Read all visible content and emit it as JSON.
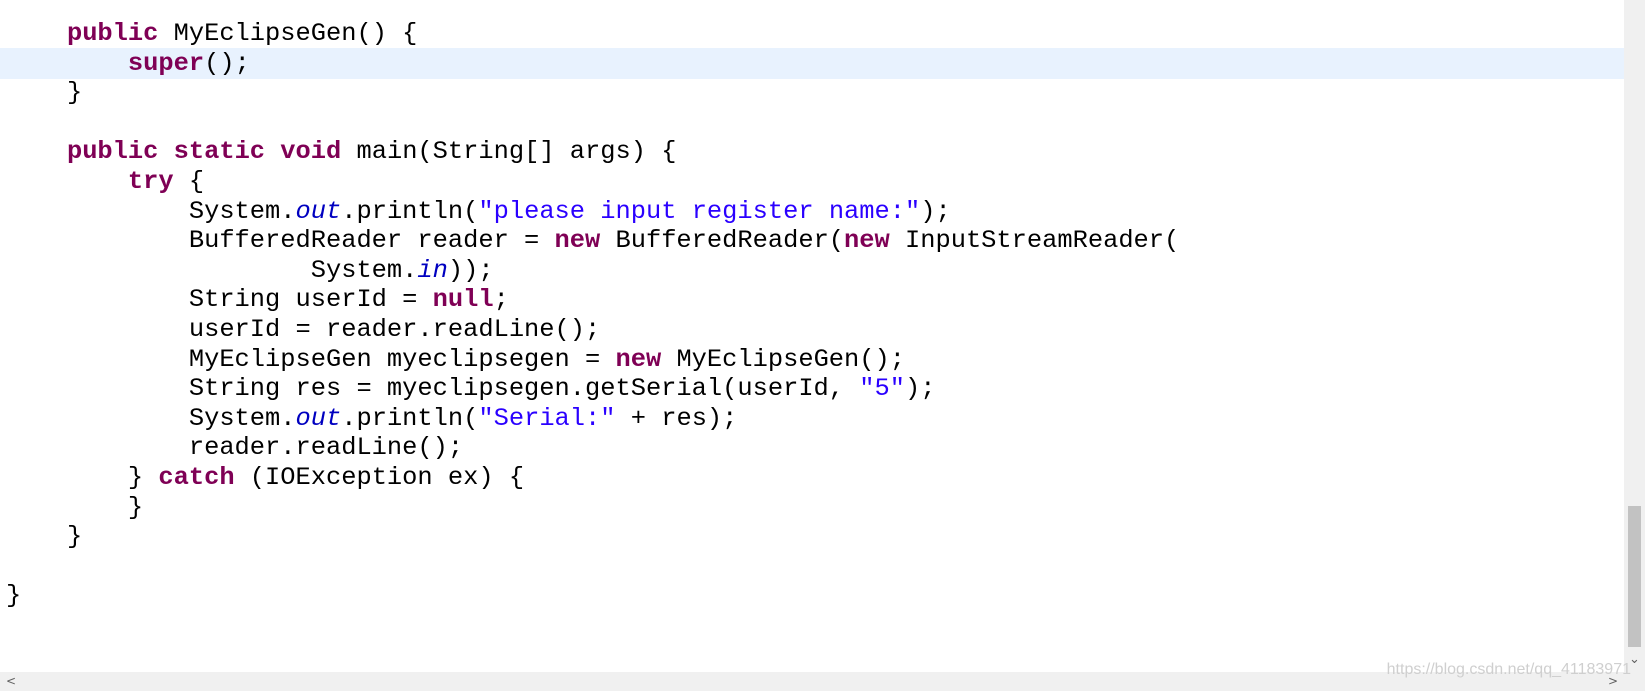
{
  "editor": {
    "lines": [
      {
        "segments": [
          [
            "",
            "    "
          ],
          [
            "kw",
            "public"
          ],
          [
            "",
            " MyEclipseGen() {"
          ]
        ]
      },
      {
        "current": true,
        "segments": [
          [
            "",
            "        "
          ],
          [
            "kw",
            "super"
          ],
          [
            "",
            "();"
          ]
        ]
      },
      {
        "segments": [
          [
            "",
            "    }"
          ]
        ]
      },
      {
        "segments": []
      },
      {
        "segments": [
          [
            "",
            "    "
          ],
          [
            "kw",
            "public"
          ],
          [
            "",
            " "
          ],
          [
            "kw",
            "static"
          ],
          [
            "",
            " "
          ],
          [
            "kw",
            "void"
          ],
          [
            "",
            " main(String[] args) {"
          ]
        ]
      },
      {
        "segments": [
          [
            "",
            "        "
          ],
          [
            "kw",
            "try"
          ],
          [
            "",
            " {"
          ]
        ]
      },
      {
        "segments": [
          [
            "",
            "            System."
          ],
          [
            "fld",
            "out"
          ],
          [
            "",
            ".println("
          ],
          [
            "str",
            "\"please input register name:\""
          ],
          [
            "",
            ");"
          ]
        ]
      },
      {
        "segments": [
          [
            "",
            "            BufferedReader reader = "
          ],
          [
            "kw",
            "new"
          ],
          [
            "",
            " BufferedReader("
          ],
          [
            "kw",
            "new"
          ],
          [
            "",
            " InputStreamReader("
          ]
        ]
      },
      {
        "segments": [
          [
            "",
            "                    System."
          ],
          [
            "fld",
            "in"
          ],
          [
            "",
            "));"
          ]
        ]
      },
      {
        "segments": [
          [
            "",
            "            String userId = "
          ],
          [
            "kw",
            "null"
          ],
          [
            "",
            ";"
          ]
        ]
      },
      {
        "segments": [
          [
            "",
            "            userId = reader.readLine();"
          ]
        ]
      },
      {
        "segments": [
          [
            "",
            "            MyEclipseGen myeclipsegen = "
          ],
          [
            "kw",
            "new"
          ],
          [
            "",
            " MyEclipseGen();"
          ]
        ]
      },
      {
        "segments": [
          [
            "",
            "            String res = myeclipsegen.getSerial(userId, "
          ],
          [
            "str",
            "\"5\""
          ],
          [
            "",
            ");"
          ]
        ]
      },
      {
        "segments": [
          [
            "",
            "            System."
          ],
          [
            "fld",
            "out"
          ],
          [
            "",
            ".println("
          ],
          [
            "str",
            "\"Serial:\""
          ],
          [
            "",
            " + res);"
          ]
        ]
      },
      {
        "segments": [
          [
            "",
            "            reader.readLine();"
          ]
        ]
      },
      {
        "segments": [
          [
            "",
            "        } "
          ],
          [
            "kw",
            "catch"
          ],
          [
            "",
            " (IOException ex) {"
          ]
        ]
      },
      {
        "segments": [
          [
            "",
            "        }"
          ]
        ]
      },
      {
        "segments": [
          [
            "",
            "    }"
          ]
        ]
      },
      {
        "segments": []
      },
      {
        "segments": [
          [
            "",
            "}"
          ]
        ]
      }
    ]
  },
  "scrollbars": {
    "down_arrow": "⌄",
    "left_arrow": "<",
    "right_arrow": ">"
  },
  "watermark": "https://blog.csdn.net/qq_41183971",
  "colors": {
    "keyword": "#7f0055",
    "string": "#2a00ff",
    "field": "#0000c0",
    "current_line": "#e8f2fe"
  }
}
